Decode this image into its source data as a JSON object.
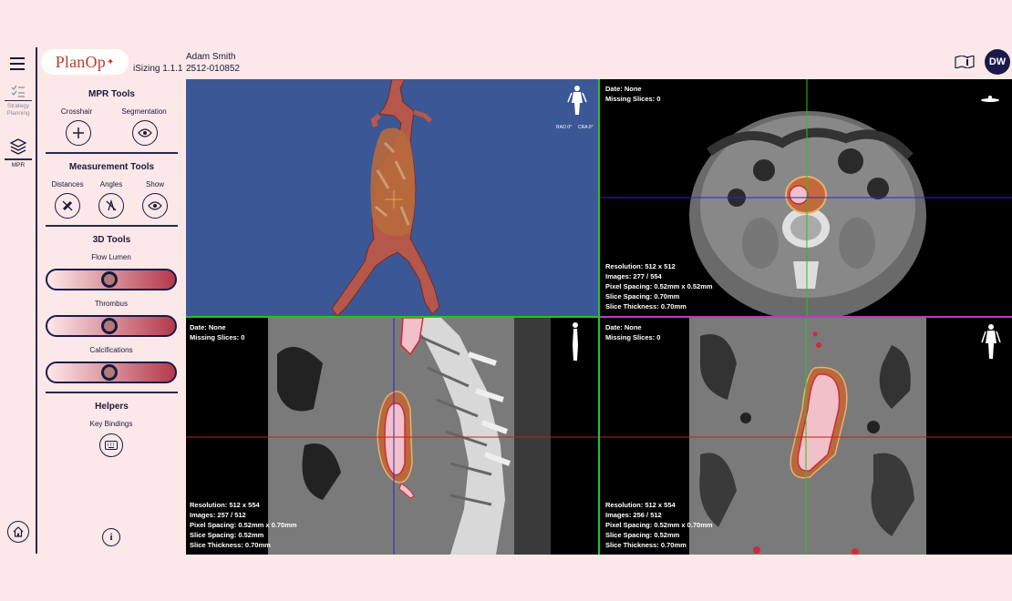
{
  "header": {
    "brand": "PlanOp",
    "app_version": "iSizing 1.1.1",
    "patient_name": "Adam Smith",
    "patient_id": "2512-010852",
    "user_initials": "DW"
  },
  "rail": {
    "strategy_label": "Strategy Planning",
    "mpr_label": "MPR"
  },
  "tools": {
    "mpr_title": "MPR Tools",
    "crosshair": "Crosshair",
    "segmentation": "Segmentation",
    "measurement_title": "Measurement Tools",
    "distances": "Distances",
    "angles": "Angles",
    "show": "Show",
    "tools3d_title": "3D Tools",
    "flow_lumen": "Flow Lumen",
    "thrombus": "Thrombus",
    "calcifications": "Calcifications",
    "helpers_title": "Helpers",
    "key_bindings": "Key Bindings",
    "sliders": {
      "flow_lumen": 0.5,
      "thrombus": 0.5,
      "calcifications": 0.5
    }
  },
  "viewports": {
    "view3d": {
      "rao": "RAO 0°",
      "cra": "CRA 0°"
    },
    "axial": {
      "date": "Date: None",
      "missing": "Missing Slices: 0",
      "resolution": "Resolution: 512 x 512",
      "images": "Images: 277 / 554",
      "pixel_spacing": "Pixel Spacing: 0.52mm x 0.52mm",
      "slice_spacing": "Slice Spacing: 0.70mm",
      "slice_thickness": "Slice Thickness: 0.70mm"
    },
    "sagittal": {
      "date": "Date: None",
      "missing": "Missing Slices: 0",
      "resolution": "Resolution: 512 x 554",
      "images": "Images: 257 / 512",
      "pixel_spacing": "Pixel Spacing: 0.52mm x 0.70mm",
      "slice_spacing": "Slice Spacing: 0.52mm",
      "slice_thickness": "Slice Thickness: 0.70mm"
    },
    "coronal": {
      "date": "Date: None",
      "missing": "Missing Slices: 0",
      "resolution": "Resolution: 512 x 554",
      "images": "Images: 256 / 512",
      "pixel_spacing": "Pixel Spacing: 0.52mm x 0.70mm",
      "slice_spacing": "Slice Spacing: 0.52mm",
      "slice_thickness": "Slice Thickness: 0.70mm"
    }
  },
  "colors": {
    "background": "#fce8e8",
    "accent": "#c0392b",
    "navy": "#1a1a4a",
    "crosshair_green": "#1ec81e",
    "crosshair_red": "#c81e1e",
    "crosshair_blue": "#2828c8",
    "crosshair_magenta": "#c832c8"
  }
}
